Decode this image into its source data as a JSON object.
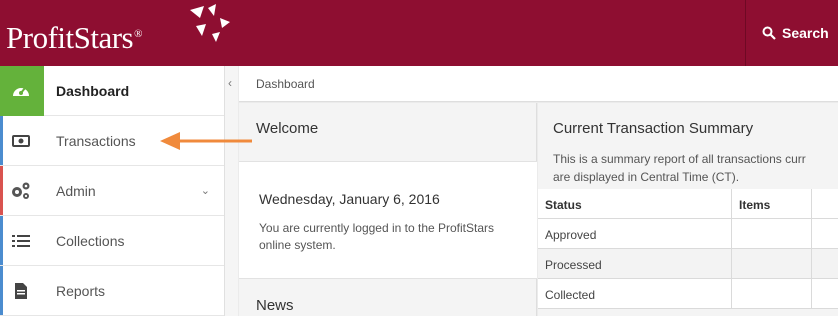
{
  "header": {
    "brand": "ProfitStars",
    "brand_mark": "®",
    "search_label": "Search"
  },
  "sidebar": {
    "items": [
      {
        "label": "Dashboard",
        "icon": "dashboard-gauge-icon"
      },
      {
        "label": "Transactions",
        "icon": "money-icon"
      },
      {
        "label": "Admin",
        "icon": "gears-icon"
      },
      {
        "label": "Collections",
        "icon": "list-icon"
      },
      {
        "label": "Reports",
        "icon": "document-icon"
      }
    ]
  },
  "breadcrumb": "Dashboard",
  "welcome": {
    "title": "Welcome",
    "date": "Wednesday, January 6, 2016",
    "message": "You are currently logged in to the ProfitStars online system.",
    "news_title": "News"
  },
  "summary": {
    "title": "Current Transaction Summary",
    "desc_line1": "This is a summary report of all transactions curr",
    "desc_line2": "are displayed in Central Time (CT).",
    "columns": [
      "Status",
      "Items",
      ""
    ],
    "rows": [
      "Approved",
      "Processed",
      "Collected"
    ]
  },
  "colors": {
    "brand": "#8e0e31",
    "active_green": "#64b23b",
    "annotation_arrow": "#f08a3c"
  }
}
